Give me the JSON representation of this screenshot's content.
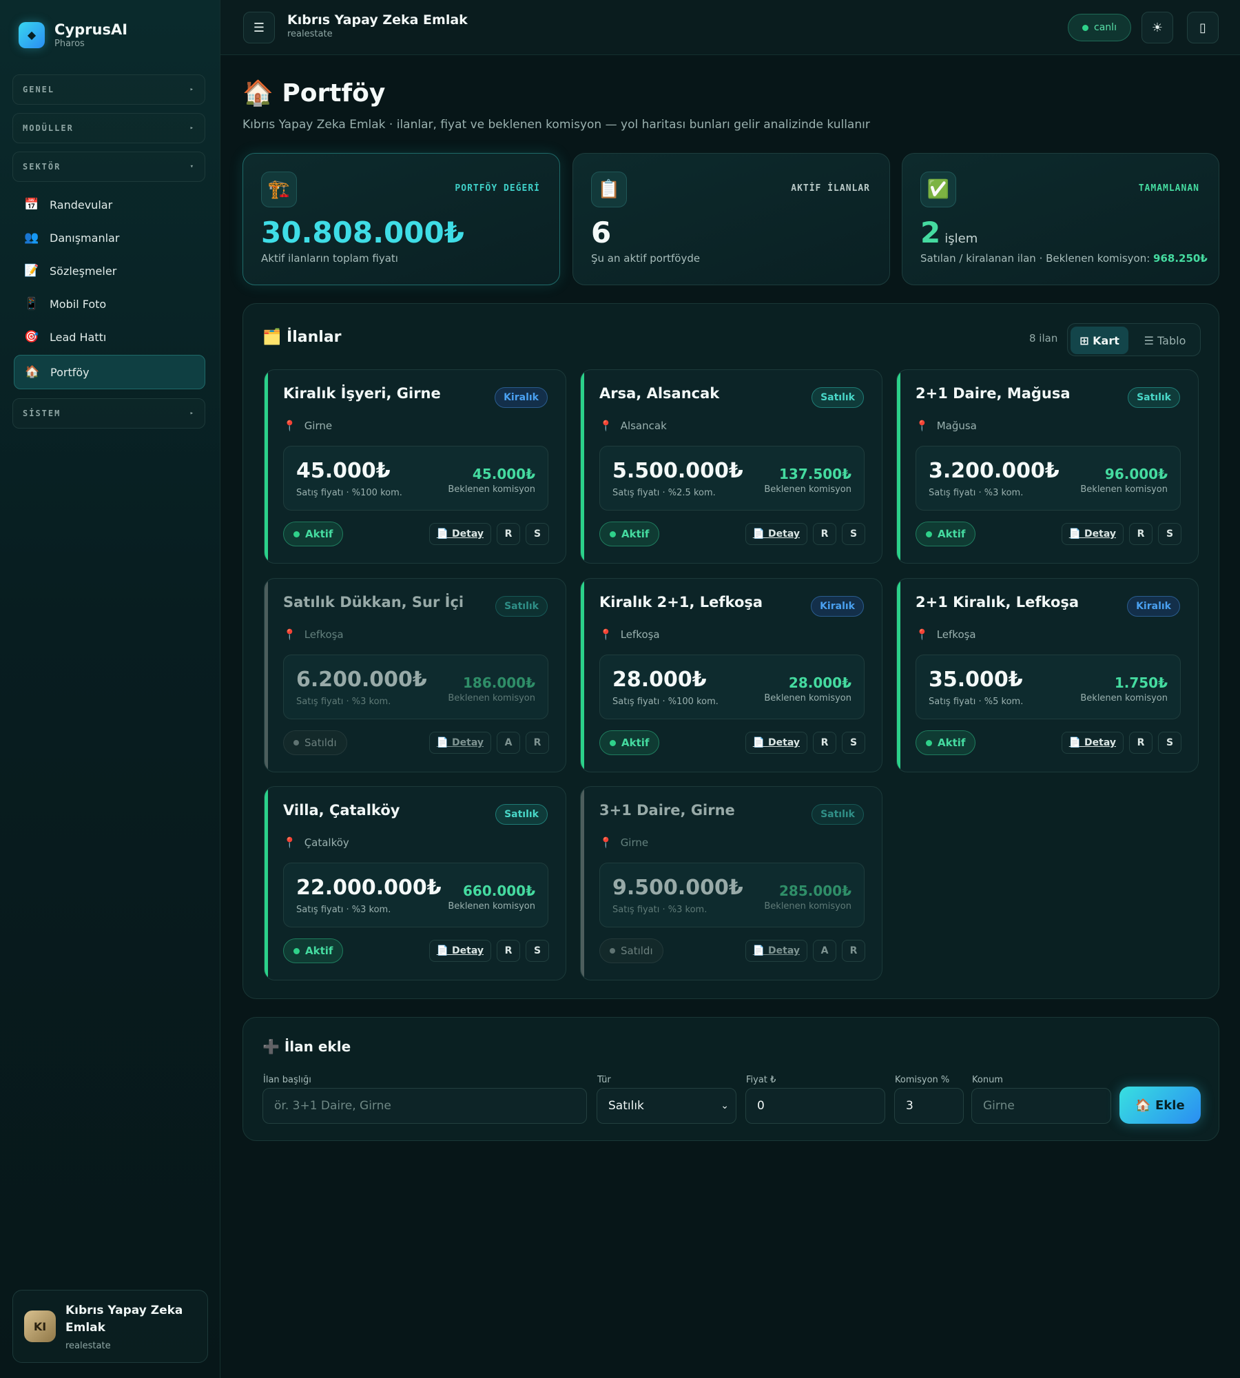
{
  "brand": {
    "name": "CyprusAI",
    "sub": "Pharos",
    "logo_icon": "◆"
  },
  "sidebar": {
    "groups": [
      {
        "label": "GENEL",
        "caret": "▸"
      },
      {
        "label": "MODÜLLER",
        "caret": "▸"
      },
      {
        "label": "SEKTÖR",
        "caret": "▾"
      },
      {
        "label": "SİSTEM",
        "caret": "▸"
      }
    ],
    "items": [
      {
        "icon": "📅",
        "label": "Randevular"
      },
      {
        "icon": "👥",
        "label": "Danışmanlar"
      },
      {
        "icon": "📝",
        "label": "Sözleşmeler"
      },
      {
        "icon": "📱",
        "label": "Mobil Foto"
      },
      {
        "icon": "🎯",
        "label": "Lead Hattı"
      },
      {
        "icon": "🏠",
        "label": "Portföy"
      }
    ],
    "active_item": "Portföy",
    "user": {
      "initials": "KI",
      "name": "Kıbrıs Yapay Zeka Emlak",
      "sub": "realestate"
    }
  },
  "topbar": {
    "menu_icon": "☰",
    "title": "Kıbrıs Yapay Zeka Emlak",
    "subtitle": "realestate",
    "live_label": "canlı",
    "theme_icon": "☀",
    "device_icon": "▯"
  },
  "page": {
    "title": "🏠 Portföy",
    "description": "Kıbrıs Yapay Zeka Emlak · ilanlar, fiyat ve beklenen komisyon — yol haritası bunları gelir analizinde kullanır"
  },
  "stats": [
    {
      "icon": "🏗️",
      "label": "PORTFÖY DEĞERİ",
      "value": "30.808.000₺",
      "unit": "",
      "note": "Aktif ilanların toplam fiyatı",
      "note_highlight": "",
      "value_color": "#3fdde6",
      "label_color": "#3fd0c8"
    },
    {
      "icon": "📋",
      "label": "AKTİF İLANLAR",
      "value": "6",
      "unit": "",
      "note": "Şu an aktif portföyde",
      "note_highlight": "",
      "value_color": "#f4f9f8",
      "label_color": "#b9c9c7"
    },
    {
      "icon": "✅",
      "label": "TAMAMLANAN",
      "value": "2",
      "unit": "işlem",
      "note": "Satılan / kiralanan ilan · Beklenen komisyon: ",
      "note_highlight": "968.250₺",
      "value_color": "#45dba0",
      "label_color": "#45dba0"
    }
  ],
  "listings": {
    "title": "🗂️ İlanlar",
    "count": "8 ilan",
    "view_card": "⊞ Kart",
    "view_table": "☰ Tablo",
    "pin_icon": "📍",
    "detail_label": "📄 Detay",
    "items": [
      {
        "title": "Kiralık İşyeri, Girne",
        "tag": "Kiralık",
        "tag_type": "rent",
        "location": "Girne",
        "price": "45.000₺",
        "price_sub": "Satış fiyatı · %100 kom.",
        "commission": "45.000₺",
        "commission_sub": "Beklenen komisyon",
        "status": "Aktif",
        "done": false,
        "actions": [
          "R",
          "S"
        ]
      },
      {
        "title": "Arsa, Alsancak",
        "tag": "Satılık",
        "tag_type": "sale",
        "location": "Alsancak",
        "price": "5.500.000₺",
        "price_sub": "Satış fiyatı · %2.5 kom.",
        "commission": "137.500₺",
        "commission_sub": "Beklenen komisyon",
        "status": "Aktif",
        "done": false,
        "actions": [
          "R",
          "S"
        ]
      },
      {
        "title": "2+1 Daire, Mağusa",
        "tag": "Satılık",
        "tag_type": "sale",
        "location": "Mağusa",
        "price": "3.200.000₺",
        "price_sub": "Satış fiyatı · %3 kom.",
        "commission": "96.000₺",
        "commission_sub": "Beklenen komisyon",
        "status": "Aktif",
        "done": false,
        "actions": [
          "R",
          "S"
        ]
      },
      {
        "title": "Satılık Dükkan, Sur İçi",
        "tag": "Satılık",
        "tag_type": "sale",
        "location": "Lefkoşa",
        "price": "6.200.000₺",
        "price_sub": "Satış fiyatı · %3 kom.",
        "commission": "186.000₺",
        "commission_sub": "Beklenen komisyon",
        "status": "Satıldı",
        "done": true,
        "actions": [
          "A",
          "R"
        ]
      },
      {
        "title": "Kiralık 2+1, Lefkoşa",
        "tag": "Kiralık",
        "tag_type": "rent",
        "location": "Lefkoşa",
        "price": "28.000₺",
        "price_sub": "Satış fiyatı · %100 kom.",
        "commission": "28.000₺",
        "commission_sub": "Beklenen komisyon",
        "status": "Aktif",
        "done": false,
        "actions": [
          "R",
          "S"
        ]
      },
      {
        "title": "2+1 Kiralık, Lefkoşa",
        "tag": "Kiralık",
        "tag_type": "rent",
        "location": "Lefkoşa",
        "price": "35.000₺",
        "price_sub": "Satış fiyatı · %5 kom.",
        "commission": "1.750₺",
        "commission_sub": "Beklenen komisyon",
        "status": "Aktif",
        "done": false,
        "actions": [
          "R",
          "S"
        ]
      },
      {
        "title": "Villa, Çatalköy",
        "tag": "Satılık",
        "tag_type": "sale",
        "location": "Çatalköy",
        "price": "22.000.000₺",
        "price_sub": "Satış fiyatı · %3 kom.",
        "commission": "660.000₺",
        "commission_sub": "Beklenen komisyon",
        "status": "Aktif",
        "done": false,
        "actions": [
          "R",
          "S"
        ]
      },
      {
        "title": "3+1 Daire, Girne",
        "tag": "Satılık",
        "tag_type": "sale",
        "location": "Girne",
        "price": "9.500.000₺",
        "price_sub": "Satış fiyatı · %3 kom.",
        "commission": "285.000₺",
        "commission_sub": "Beklenen komisyon",
        "status": "Satıldı",
        "done": true,
        "actions": [
          "A",
          "R"
        ]
      }
    ]
  },
  "add_form": {
    "title": "➕ İlan ekle",
    "fields": {
      "title": {
        "label": "İlan başlığı",
        "placeholder": "ör. 3+1 Daire, Girne",
        "value": ""
      },
      "type": {
        "label": "Tür",
        "value": "Satılık"
      },
      "price": {
        "label": "Fiyat ₺",
        "value": "0"
      },
      "commission": {
        "label": "Komisyon %",
        "value": "3"
      },
      "location": {
        "label": "Konum",
        "placeholder": "Girne",
        "value": ""
      }
    },
    "submit_label": "🏠 Ekle"
  }
}
